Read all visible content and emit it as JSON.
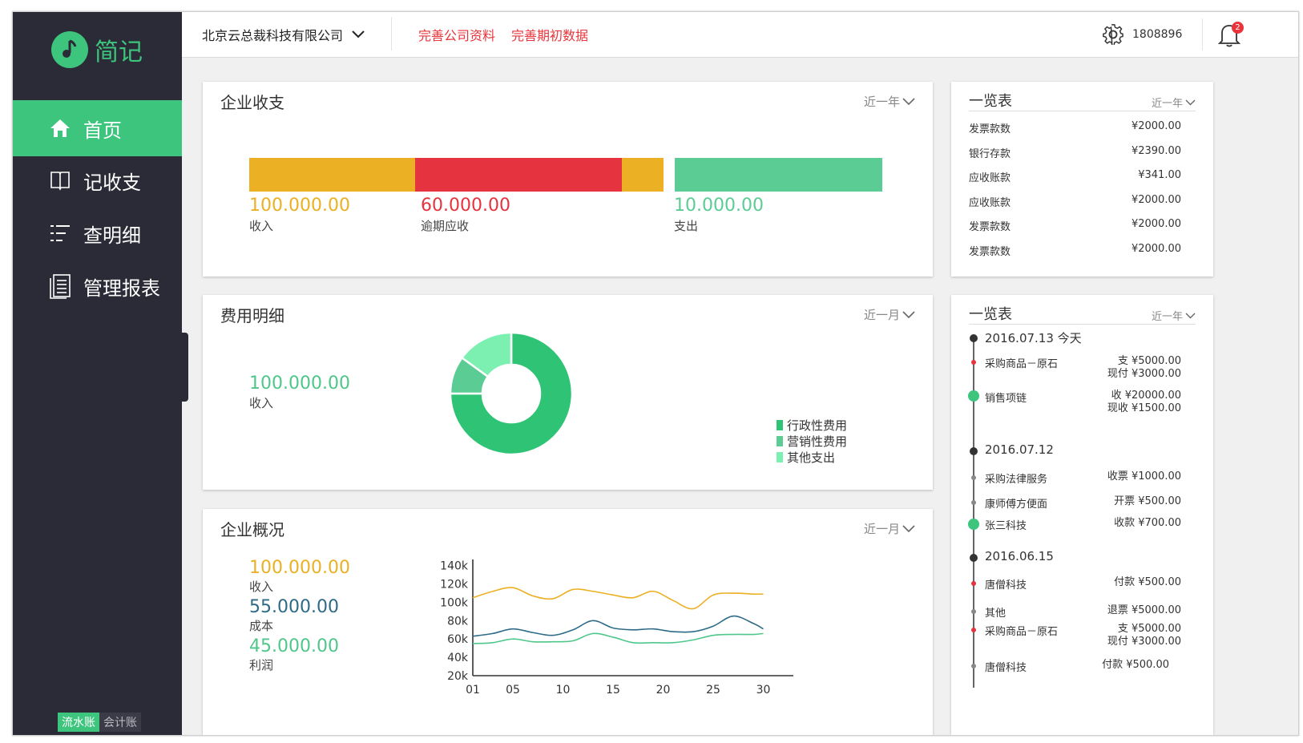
{
  "sidebar": {
    "brand": "简记",
    "nav": [
      {
        "label": "首页"
      },
      {
        "label": "记收支"
      },
      {
        "label": "查明细"
      },
      {
        "label": "管理报表"
      }
    ],
    "mode_options": [
      "流水账",
      "会计账"
    ]
  },
  "topbar": {
    "company": "北京云总裁科技有限公司",
    "link_profile": "完善公司资料",
    "link_initial": "完善期初数据",
    "username": "1808896",
    "notification_count": "2"
  },
  "income_card": {
    "title": "企业收支",
    "period": "近一年",
    "bar_segments": {
      "income_fraction": 0.4,
      "overdue_fraction": 0.5,
      "remainder_fraction": 0.1,
      "expense_fraction": 1.0
    },
    "income_value": "100.000.00",
    "income_label": "收入",
    "overdue_value": "60.000.00",
    "overdue_label": "逾期应收",
    "expense_value": "10.000.00",
    "expense_label": "支出",
    "colors": {
      "income": "#ebb023",
      "overdue": "#e5343f",
      "expense": "#5bcc94"
    }
  },
  "expense_card": {
    "title": "费用明细",
    "period": "近一月",
    "income_value": "100.000.00",
    "income_label": "收入",
    "legend": [
      {
        "name": "行政性费用",
        "color": "#2fc475"
      },
      {
        "name": "营销性费用",
        "color": "#5bcc94"
      },
      {
        "name": "其他支出",
        "color": "#7cf0b0"
      }
    ]
  },
  "overview_card": {
    "title": "企业概况",
    "period": "近一月",
    "income_value": "100.000.00",
    "income_label": "收入",
    "cost_value": "55.000.00",
    "cost_label": "成本",
    "profit_value": "45.000.00",
    "profit_label": "利润"
  },
  "chart_data": [
    {
      "type": "pie",
      "donut": true,
      "slices": [
        {
          "name": "行政性费用",
          "value": 75,
          "color": "#2fc475"
        },
        {
          "name": "营销性费用",
          "value": 10,
          "color": "#5bcc94"
        },
        {
          "name": "其他支出",
          "value": 15,
          "color": "#7cf0b0"
        }
      ]
    },
    {
      "type": "line",
      "x": [
        1,
        3,
        5,
        7,
        9,
        11,
        13,
        15,
        17,
        19,
        21,
        23,
        25,
        27,
        29,
        30
      ],
      "xticks": [
        "01",
        "05",
        "10",
        "15",
        "20",
        "25",
        "30"
      ],
      "xtick_values": [
        1,
        5,
        10,
        15,
        20,
        25,
        30
      ],
      "yticks": [
        "20k",
        "40k",
        "60k",
        "80k",
        "100k",
        "120k",
        "140k"
      ],
      "ytick_values": [
        20,
        40,
        60,
        80,
        100,
        120,
        140
      ],
      "ylim": [
        20,
        145
      ],
      "xlim": [
        1,
        33
      ],
      "series": [
        {
          "values": [
            105,
            112,
            116,
            107,
            104,
            114,
            112,
            108,
            105,
            112,
            102,
            93,
            108,
            110,
            109,
            109
          ],
          "color": "#ebb023"
        },
        {
          "values": [
            63,
            66,
            71,
            67,
            64,
            70,
            80,
            72,
            70,
            71,
            68,
            68,
            74,
            85,
            77,
            71
          ],
          "color": "#2e6b86"
        },
        {
          "values": [
            55,
            56,
            60,
            57,
            57,
            58,
            66,
            62,
            56,
            56,
            56,
            59,
            64,
            65,
            65,
            66
          ],
          "color": "#4fc78a"
        }
      ]
    }
  ],
  "summary_card": {
    "title": "一览表",
    "period": "近一年",
    "rows": [
      {
        "label": "发票款数",
        "value": "¥2000.00"
      },
      {
        "label": "银行存款",
        "value": "¥2390.00"
      },
      {
        "label": "应收账款",
        "value": "¥341.00"
      },
      {
        "label": "应收账款",
        "value": "¥2000.00"
      },
      {
        "label": "发票款数",
        "value": "¥2000.00"
      },
      {
        "label": "发票款数",
        "value": "¥2000.00"
      }
    ]
  },
  "timeline_card": {
    "title": "一览表",
    "period": "近一年",
    "groups": [
      {
        "date": "2016.07.13  今天"
      },
      {
        "date": "2016.07.12"
      },
      {
        "date": "2016.06.15"
      }
    ],
    "entries": [
      {
        "name": "采购商品－原石",
        "amount1": "支  ¥5000.00",
        "amount2": "现付  ¥3000.00"
      },
      {
        "name": "销售项链",
        "amount1": "收  ¥20000.00",
        "amount2": "现收  ¥1500.00"
      },
      {
        "name": "采购法律服务",
        "amount1": "收票  ¥1000.00"
      },
      {
        "name": "康师傅方便面",
        "amount1": "开票  ¥500.00"
      },
      {
        "name": "张三科技",
        "amount1": "收款  ¥700.00"
      },
      {
        "name": "唐僧科技",
        "amount1": "付款  ¥500.00"
      },
      {
        "name": "其他",
        "amount1": "退票  ¥5000.00"
      },
      {
        "name": "采购商品－原石",
        "amount1": "支  ¥5000.00",
        "amount2": "现付  ¥3000.00"
      },
      {
        "name": "唐僧科技",
        "amount1": "付款  ¥500.00"
      }
    ]
  }
}
